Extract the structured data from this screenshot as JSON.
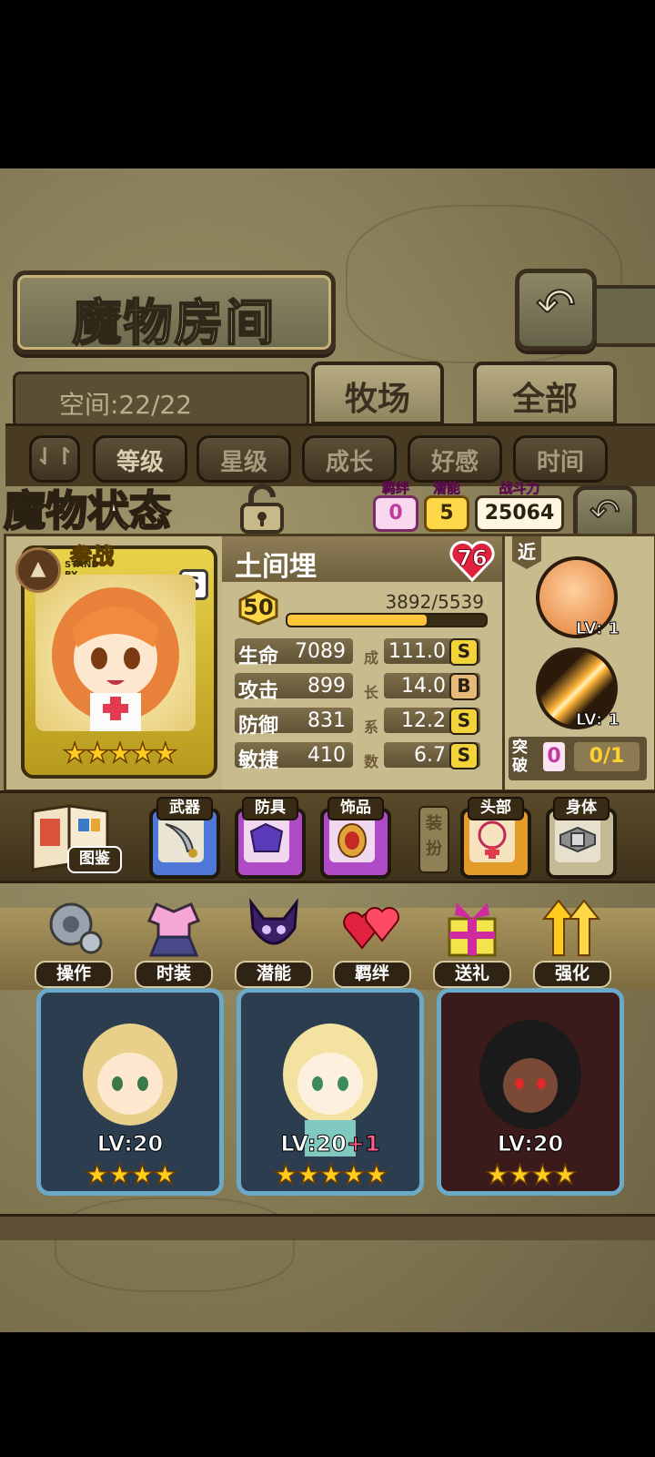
{
  "header": {
    "title": "魔物房间",
    "back_icon": "return-arrow-icon"
  },
  "space": {
    "label": "空间:22/22"
  },
  "tabs": [
    {
      "label": "牧场"
    },
    {
      "label": "全部"
    }
  ],
  "filters": [
    {
      "label": "等级"
    },
    {
      "label": "星级"
    },
    {
      "label": "成长"
    },
    {
      "label": "好感"
    },
    {
      "label": "时间"
    }
  ],
  "status": {
    "title": "魔物状态",
    "bond": {
      "label": "羁绊",
      "value": "0"
    },
    "potential": {
      "label": "潜能",
      "value": "5"
    },
    "power": {
      "label": "战斗力",
      "value": "25064"
    }
  },
  "card": {
    "standby": "参战",
    "standby_en": "STAND BY",
    "grade": "S",
    "stars": "★★★★★",
    "star_count": 5
  },
  "monster": {
    "name": "土间埋",
    "affection": "76",
    "level": "50",
    "exp_text": "3892/5539",
    "exp_fraction": 0.7027,
    "stats": [
      {
        "key": "生命",
        "value": "7089",
        "growth": "111.0",
        "grade": "S"
      },
      {
        "key": "攻击",
        "value": "899",
        "growth": "14.0",
        "grade": "B"
      },
      {
        "key": "防御",
        "value": "831",
        "growth": "12.2",
        "grade": "S"
      },
      {
        "key": "敏捷",
        "value": "410",
        "growth": "6.7",
        "grade": "S"
      }
    ],
    "growth_label": [
      "成",
      "长",
      "系",
      "数"
    ]
  },
  "skills": {
    "range": "近",
    "items": [
      {
        "lv": "LV: 1"
      },
      {
        "lv": "LV: 1"
      }
    ]
  },
  "breakthrough": {
    "label": "突破",
    "count": "0",
    "progress": "0/1"
  },
  "equipment": {
    "book_label": "图鉴",
    "dress_label": "装扮",
    "slots": [
      {
        "label": "武器",
        "color": "#4f78d6"
      },
      {
        "label": "防具",
        "color": "#b04bc8"
      },
      {
        "label": "饰品",
        "color": "#b04bc8"
      },
      {
        "label": "头部",
        "color": "#e49b2a"
      },
      {
        "label": "身体",
        "color": "#c4bb95"
      }
    ]
  },
  "actions": [
    {
      "label": "操作",
      "icon": "gear-icon"
    },
    {
      "label": "时装",
      "icon": "outfit-icon"
    },
    {
      "label": "潜能",
      "icon": "demon-icon"
    },
    {
      "label": "羁绊",
      "icon": "hearts-icon"
    },
    {
      "label": "送礼",
      "icon": "gift-icon"
    },
    {
      "label": "强化",
      "icon": "upgrade-arrows-icon"
    }
  ],
  "list": [
    {
      "lv": "LV:20",
      "plus": "",
      "stars": "★★★★"
    },
    {
      "lv": "LV:20",
      "plus": "+1",
      "stars": "★★★★★"
    },
    {
      "lv": "LV:20",
      "plus": "",
      "stars": "★★★★"
    }
  ]
}
